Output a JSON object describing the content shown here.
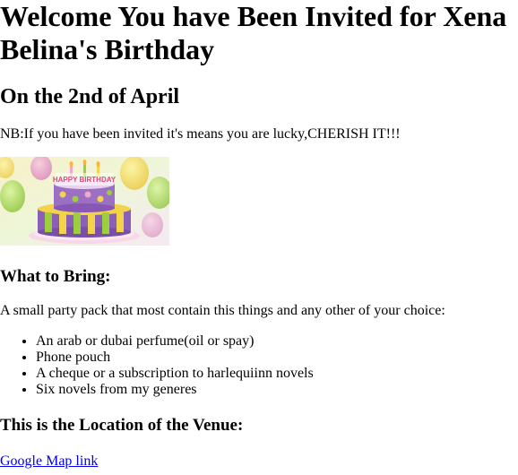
{
  "page": {
    "title": "Welcome You have Been Invited for Xena Belina's Birthday",
    "date": "On the 2nd of April",
    "note": "NB:If you have been invited it's means you are lucky,CHERISH IT!!!",
    "image": {
      "banner_text": "HAPPY BIRTHDAY",
      "colors": {
        "cake_purple": "#8b5fb8",
        "cake_green": "#9ccf3e",
        "cake_yellow": "#f3d34a",
        "cake_pink": "#f2a6c9"
      }
    },
    "bring": {
      "heading": "What to Bring:",
      "intro": "A small party pack that most contain this things and any other of your choice:",
      "items": [
        "An arab or dubai perfume(oil or spay)",
        "Phone pouch",
        "A cheque or a subscription to harlequiinn novels",
        "Six novels from my generes"
      ]
    },
    "venue": {
      "heading": "This is the Location of the Venue:",
      "link_text": "Google Map link",
      "link_color": "#0000ee"
    }
  }
}
